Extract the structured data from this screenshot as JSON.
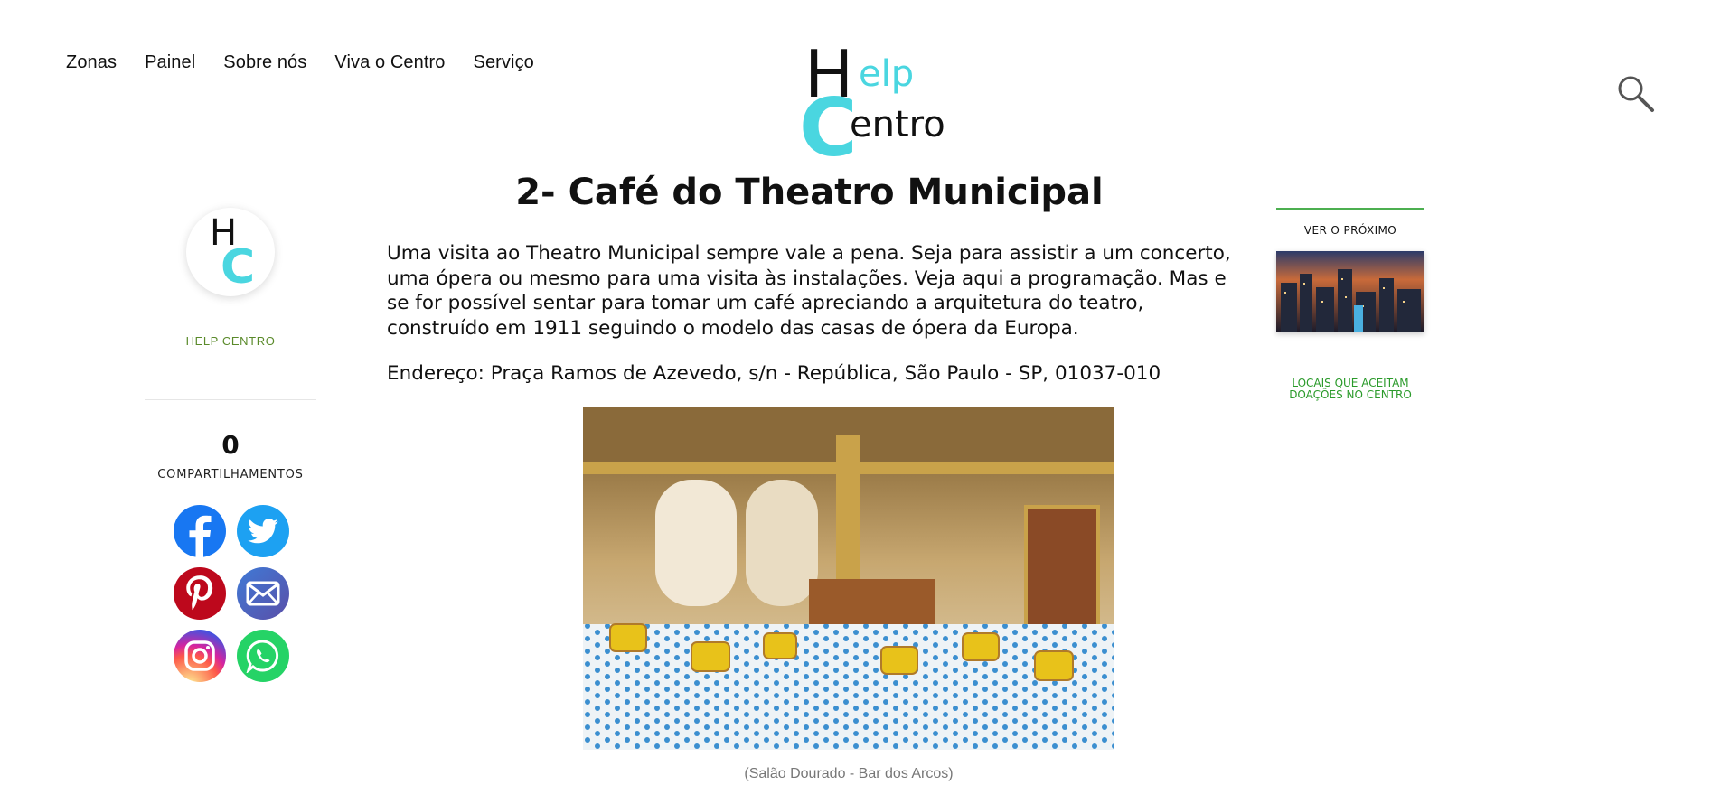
{
  "nav": {
    "items": [
      {
        "label": "Zonas"
      },
      {
        "label": "Painel"
      },
      {
        "label": "Sobre nós"
      },
      {
        "label": "Viva o Centro"
      },
      {
        "label": "Serviço"
      }
    ]
  },
  "logo": {
    "part_h": "H",
    "part_elp": "elp",
    "part_c": "C",
    "part_entro": "entro"
  },
  "search": {
    "icon": "search-icon"
  },
  "author": {
    "avatar_h": "H",
    "avatar_c": "C",
    "name": "HELP CENTRO"
  },
  "shares": {
    "count": "0",
    "label": "COMPARTILHAMENTOS",
    "buttons": [
      {
        "icon": "facebook-icon",
        "color": "#1877f2"
      },
      {
        "icon": "twitter-icon",
        "color": "#1da1f2"
      },
      {
        "icon": "pinterest-icon",
        "color": "#bd081c"
      },
      {
        "icon": "email-icon",
        "color": "#4b62b3"
      },
      {
        "icon": "instagram-icon",
        "color": "#d6249f"
      },
      {
        "icon": "whatsapp-icon",
        "color": "#25d366"
      }
    ]
  },
  "article": {
    "title": "2- Café do Theatro Municipal",
    "paragraph": "Uma visita ao Theatro Municipal sempre vale a pena. Seja para assistir a um concerto, uma ópera ou mesmo para uma visita às instalações. Veja aqui a programação. Mas e se for possível sentar para tomar um café apreciando a arquitetura do teatro, construído em 1911 seguindo o modelo das casas de ópera da Europa.",
    "address": "Endereço: Praça Ramos de Azevedo, s/n - República, São Paulo - SP, 01037-010",
    "image_caption": "(Salão Dourado - Bar dos Arcos)"
  },
  "sidebar_right": {
    "next_label": "VER O PRÓXIMO",
    "link_line1": "LOCAIS QUE ACEITAM",
    "link_line2": "DOAÇÕES NO CENTRO"
  },
  "colors": {
    "accent_cyan": "#4ad6e0",
    "author_green": "#5a8a2a",
    "link_green": "#2a9a2a"
  }
}
